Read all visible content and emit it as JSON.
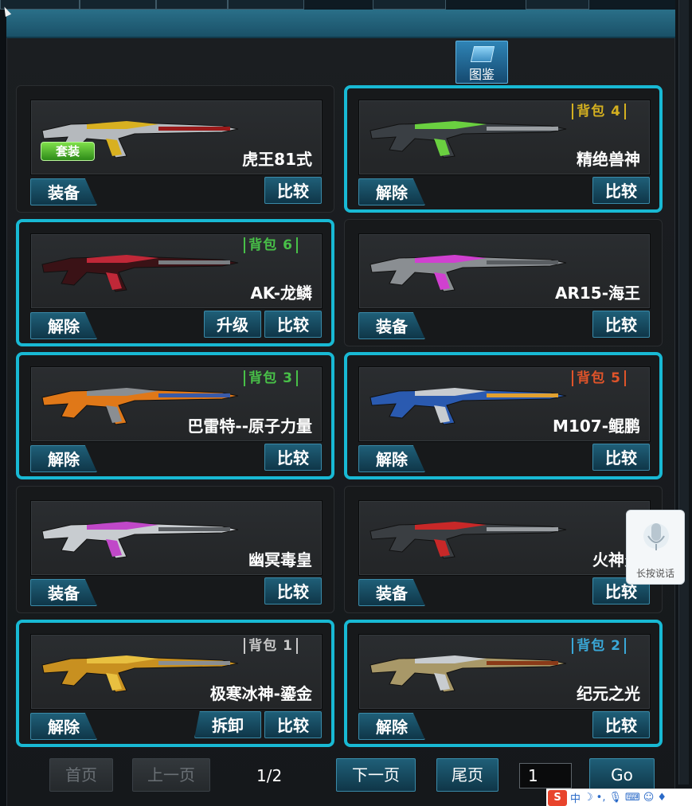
{
  "header": {
    "catalog_label": "图鉴"
  },
  "cards": [
    {
      "name": "虎王81式",
      "slot": "",
      "slot_color": "",
      "selected": false,
      "left_btn": "装备",
      "mid_btn": "",
      "cmp_btn": "比较",
      "suit": "套装",
      "gun_colors": [
        "#b5b9bd",
        "#d8b020",
        "#9a1a1a"
      ]
    },
    {
      "name": "精绝兽神",
      "slot": "背包 4",
      "slot_color": "#d4b020",
      "selected": true,
      "left_btn": "解除",
      "mid_btn": "",
      "cmp_btn": "比较",
      "suit": "",
      "gun_colors": [
        "#3a3f44",
        "#6ad040",
        "#9a9ea2"
      ]
    },
    {
      "name": "AK-龙鳞",
      "slot": "背包 6",
      "slot_color": "#48c048",
      "selected": true,
      "left_btn": "解除",
      "mid_btn": "升级",
      "cmp_btn": "比较",
      "suit": "",
      "gun_colors": [
        "#3a1216",
        "#c02838",
        "#7a7e82"
      ]
    },
    {
      "name": "AR15-海王",
      "slot": "",
      "slot_color": "",
      "selected": false,
      "left_btn": "装备",
      "mid_btn": "",
      "cmp_btn": "比较",
      "suit": "",
      "gun_colors": [
        "#8a8e92",
        "#d040d0",
        "#5a5e62"
      ]
    },
    {
      "name": "巴雷特--原子力量",
      "slot": "背包 3",
      "slot_color": "#48c048",
      "selected": true,
      "left_btn": "解除",
      "mid_btn": "",
      "cmp_btn": "比较",
      "suit": "",
      "gun_colors": [
        "#e07818",
        "#8a8e92",
        "#3a5aa8"
      ]
    },
    {
      "name": "M107-鲲鹏",
      "slot": "背包 5",
      "slot_color": "#e0542a",
      "selected": true,
      "left_btn": "解除",
      "mid_btn": "",
      "cmp_btn": "比较",
      "suit": "",
      "gun_colors": [
        "#2a5ab0",
        "#c8ccd0",
        "#e0a030"
      ]
    },
    {
      "name": "幽冥毒皇",
      "slot": "",
      "slot_color": "",
      "selected": false,
      "left_btn": "装备",
      "mid_btn": "",
      "cmp_btn": "比较",
      "suit": "",
      "gun_colors": [
        "#c8ccd0",
        "#c048c8",
        "#5a5e62"
      ]
    },
    {
      "name": "火神炎",
      "slot": "",
      "slot_color": "",
      "selected": false,
      "left_btn": "装备",
      "mid_btn": "",
      "cmp_btn": "比较",
      "suit": "",
      "gun_colors": [
        "#3a3e42",
        "#c82828",
        "#9a9ea2"
      ]
    },
    {
      "name": "极寒冰神-鎏金",
      "slot": "背包 1",
      "slot_color": "#c8c8c8",
      "selected": true,
      "left_btn": "解除",
      "mid_btn": "拆卸",
      "cmp_btn": "比较",
      "suit": "",
      "gun_colors": [
        "#c89020",
        "#e8c040",
        "#8a8e92"
      ]
    },
    {
      "name": "纪元之光",
      "slot": "背包 2",
      "slot_color": "#3aa8d8",
      "selected": true,
      "left_btn": "解除",
      "mid_btn": "",
      "cmp_btn": "比较",
      "suit": "",
      "gun_colors": [
        "#a89868",
        "#c8ccd0",
        "#8a3a18"
      ]
    }
  ],
  "pager": {
    "first": "首页",
    "prev": "上一页",
    "info": "1/2",
    "next": "下一页",
    "last": "尾页",
    "page_value": "1",
    "go": "Go"
  },
  "voice": {
    "label": "长按说话",
    "icon": "microphone-icon"
  },
  "ime": {
    "logo": "S",
    "mode": "中"
  }
}
